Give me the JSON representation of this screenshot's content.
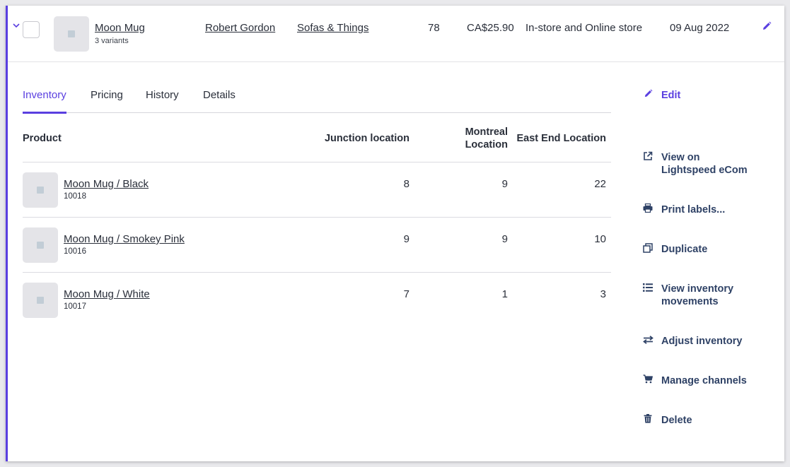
{
  "product": {
    "name": "Moon Mug",
    "variants_label": "3 variants",
    "supplier": "Robert Gordon",
    "brand": "Sofas & Things",
    "quantity": "78",
    "price": "CA$25.90",
    "channels": "In-store and Online store",
    "date": "09 Aug 2022"
  },
  "tabs": [
    {
      "label": "Inventory",
      "active": true
    },
    {
      "label": "Pricing",
      "active": false
    },
    {
      "label": "History",
      "active": false
    },
    {
      "label": "Details",
      "active": false
    }
  ],
  "table": {
    "headers": {
      "product": "Product",
      "junction": "Junction location",
      "montreal_line1": "Montreal",
      "montreal_line2": "Location",
      "east_end": "East End Location"
    },
    "rows": [
      {
        "name": "Moon Mug / Black",
        "sku": "10018",
        "junction": "8",
        "montreal": "9",
        "east_end": "22"
      },
      {
        "name": "Moon Mug / Smokey Pink",
        "sku": "10016",
        "junction": "9",
        "montreal": "9",
        "east_end": "10"
      },
      {
        "name": "Moon Mug / White",
        "sku": "10017",
        "junction": "7",
        "montreal": "1",
        "east_end": "3"
      }
    ]
  },
  "actions": {
    "edit": "Edit",
    "view_line1": "View on",
    "view_line2": "Lightspeed eCom",
    "print": "Print labels...",
    "duplicate": "Duplicate",
    "movements_line1": "View inventory",
    "movements_line2": "movements",
    "adjust": "Adjust inventory",
    "channels": "Manage channels",
    "delete": "Delete"
  },
  "icons": {
    "chevron": "chevron-down-icon",
    "pencil": "pencil-icon",
    "external": "external-link-icon",
    "print": "printer-icon",
    "duplicate": "duplicate-icon",
    "list": "list-icon",
    "adjust": "arrows-exchange-icon",
    "cart": "cart-icon",
    "trash": "trash-icon"
  },
  "colors": {
    "accent": "#5a3fe0",
    "action_text": "#2f4266"
  }
}
